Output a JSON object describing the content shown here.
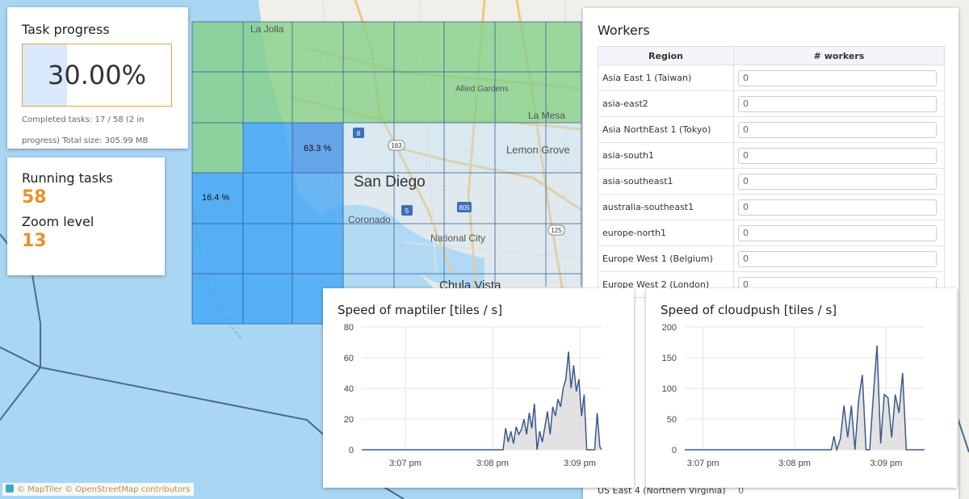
{
  "task": {
    "title": "Task progress",
    "percent_text": "30.00%",
    "percent": 0.3,
    "info": "Completed tasks: 17 / 58 (2 in progress) Total size: 305.99 MB"
  },
  "running": {
    "label": "Running tasks",
    "value": "58",
    "zoom_label": "Zoom level",
    "zoom_value": "13"
  },
  "map": {
    "places": [
      "La Jolla",
      "San Diego",
      "Lemon Grove",
      "Coronado",
      "National City",
      "Chula Vista",
      "La Mesa",
      "Allied Gardens"
    ],
    "road_shields": [
      "8",
      "163",
      "5",
      "805",
      "125"
    ],
    "tile_labels": [
      "63.3 %",
      "16.4 %"
    ],
    "colors": {
      "done": "#8fd18d",
      "active": "#3a8fe8",
      "pending": "#5aaef6"
    }
  },
  "workers": {
    "title": "Workers",
    "col_region": "Region",
    "col_workers": "# workers",
    "rows": [
      {
        "region": "Asia East 1 (Taiwan)",
        "count": "0"
      },
      {
        "region": "asia-east2",
        "count": "0"
      },
      {
        "region": "Asia NorthEast 1 (Tokyo)",
        "count": "0"
      },
      {
        "region": "asia-south1",
        "count": "0"
      },
      {
        "region": "asia-southeast1",
        "count": "0"
      },
      {
        "region": "australia-southeast1",
        "count": "0"
      },
      {
        "region": "europe-north1",
        "count": "0"
      },
      {
        "region": "Europe West 1 (Belgium)",
        "count": "0"
      },
      {
        "region": "Europe West 2 (London)",
        "count": "0"
      }
    ],
    "last_row": {
      "region": "US East 4 (Northern Virginia)",
      "count": "0"
    }
  },
  "attribution": "© MapTiler © OpenStreetMap contributors",
  "chart_data": [
    {
      "type": "area",
      "title": "Speed of maptiler [tiles / s]",
      "ylim": [
        0,
        80
      ],
      "yticks": [
        0,
        20,
        40,
        60,
        80
      ],
      "xticks": [
        "3:07 pm",
        "3:08 pm",
        "3:09 pm"
      ],
      "xtick_positions": [
        0.5,
        1.5,
        2.5
      ],
      "xlim": [
        0,
        2.75
      ],
      "color": "#3c5a8a",
      "x": [
        0,
        1.62,
        1.65,
        1.68,
        1.71,
        1.74,
        1.77,
        1.8,
        1.83,
        1.86,
        1.89,
        1.92,
        1.95,
        1.98,
        2.01,
        2.04,
        2.07,
        2.1,
        2.13,
        2.16,
        2.19,
        2.22,
        2.25,
        2.28,
        2.31,
        2.34,
        2.37,
        2.4,
        2.43,
        2.46,
        2.49,
        2.52,
        2.55,
        2.58,
        2.61,
        2.64,
        2.67,
        2.7,
        2.73,
        2.75
      ],
      "y": [
        0,
        0,
        14,
        5,
        12,
        4,
        15,
        10,
        13,
        20,
        10,
        24,
        14,
        30,
        0,
        12,
        5,
        15,
        25,
        10,
        28,
        22,
        33,
        28,
        40,
        46,
        64,
        40,
        55,
        38,
        46,
        22,
        36,
        0,
        0,
        0,
        0,
        24,
        2,
        0
      ]
    },
    {
      "type": "area",
      "title": "Speed of cloudpush [tiles / s]",
      "ylim": [
        0,
        200
      ],
      "yticks": [
        0,
        50,
        100,
        150,
        200
      ],
      "xticks": [
        "3:07 pm",
        "3:08 pm",
        "3:09 pm"
      ],
      "xtick_positions": [
        0.2,
        1.2,
        2.2
      ],
      "xlim": [
        0,
        2.62
      ],
      "color": "#3c5a8a",
      "x": [
        0,
        1.6,
        1.63,
        1.66,
        1.7,
        1.74,
        1.78,
        1.82,
        1.86,
        1.9,
        1.94,
        1.98,
        2.02,
        2.06,
        2.1,
        2.14,
        2.18,
        2.22,
        2.26,
        2.3,
        2.34,
        2.38,
        2.42,
        2.46,
        2.5,
        2.54,
        2.58,
        2.62
      ],
      "y": [
        0,
        0,
        22,
        0,
        18,
        72,
        20,
        72,
        0,
        82,
        122,
        0,
        0,
        88,
        170,
        10,
        90,
        85,
        20,
        90,
        60,
        125,
        0,
        0,
        0,
        0,
        0,
        0
      ]
    }
  ]
}
